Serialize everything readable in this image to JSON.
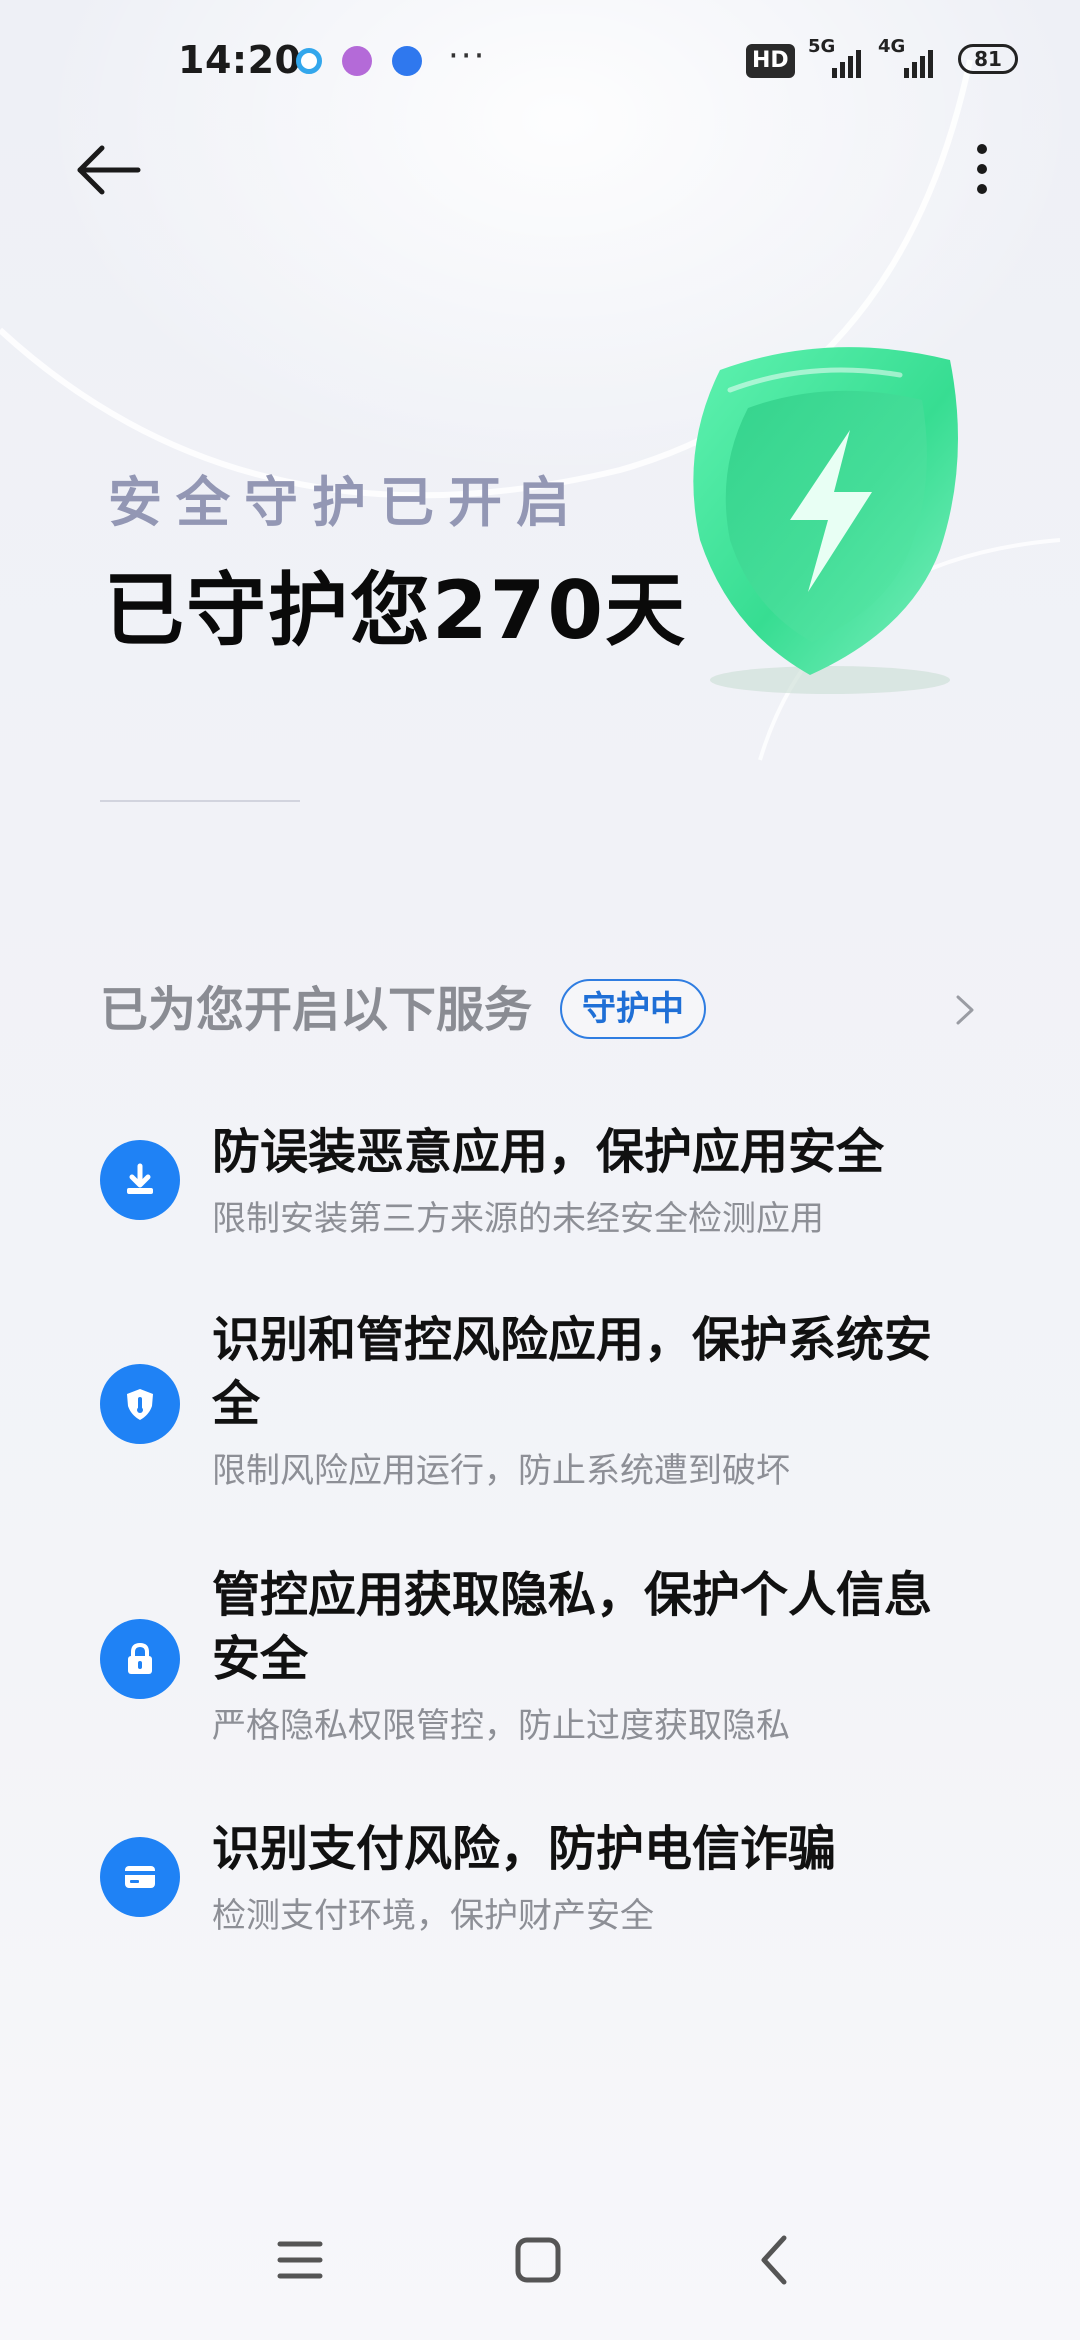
{
  "status_bar": {
    "time": "14:20",
    "more_indicator": "···",
    "hd_label": "HD",
    "network_1": "5G",
    "network_2": "4G",
    "battery": "81"
  },
  "toolbar": {
    "back_icon": "arrow-left-icon",
    "more_icon": "more-vertical-icon"
  },
  "hero": {
    "subtitle": "安全守护已开启",
    "title": "已守护您270天",
    "shield_icon": "shield-lightning-icon",
    "accent_color": "#3fe39a"
  },
  "services": {
    "header": "已为您开启以下服务",
    "status": "守护中",
    "status_color": "#1f6fd6",
    "items": [
      {
        "icon": "download-icon",
        "title": "防误装恶意应用，保护应用安全",
        "desc": "限制安装第三方来源的未经安全检测应用"
      },
      {
        "icon": "shield-icon",
        "title": "识别和管控风险应用，保护系统安全",
        "desc": "限制风险应用运行，防止系统遭到破坏"
      },
      {
        "icon": "lock-icon",
        "title": "管控应用获取隐私，保护个人信息安全",
        "desc": "严格隐私权限管控，防止过度获取隐私"
      },
      {
        "icon": "card-icon",
        "title": "识别支付风险，防护电信诈骗",
        "desc": "检测支付环境，保护财产安全"
      }
    ]
  },
  "nav_bar": {
    "menu_icon": "menu-icon",
    "home_icon": "home-square-icon",
    "back_icon": "back-chevron-icon"
  }
}
